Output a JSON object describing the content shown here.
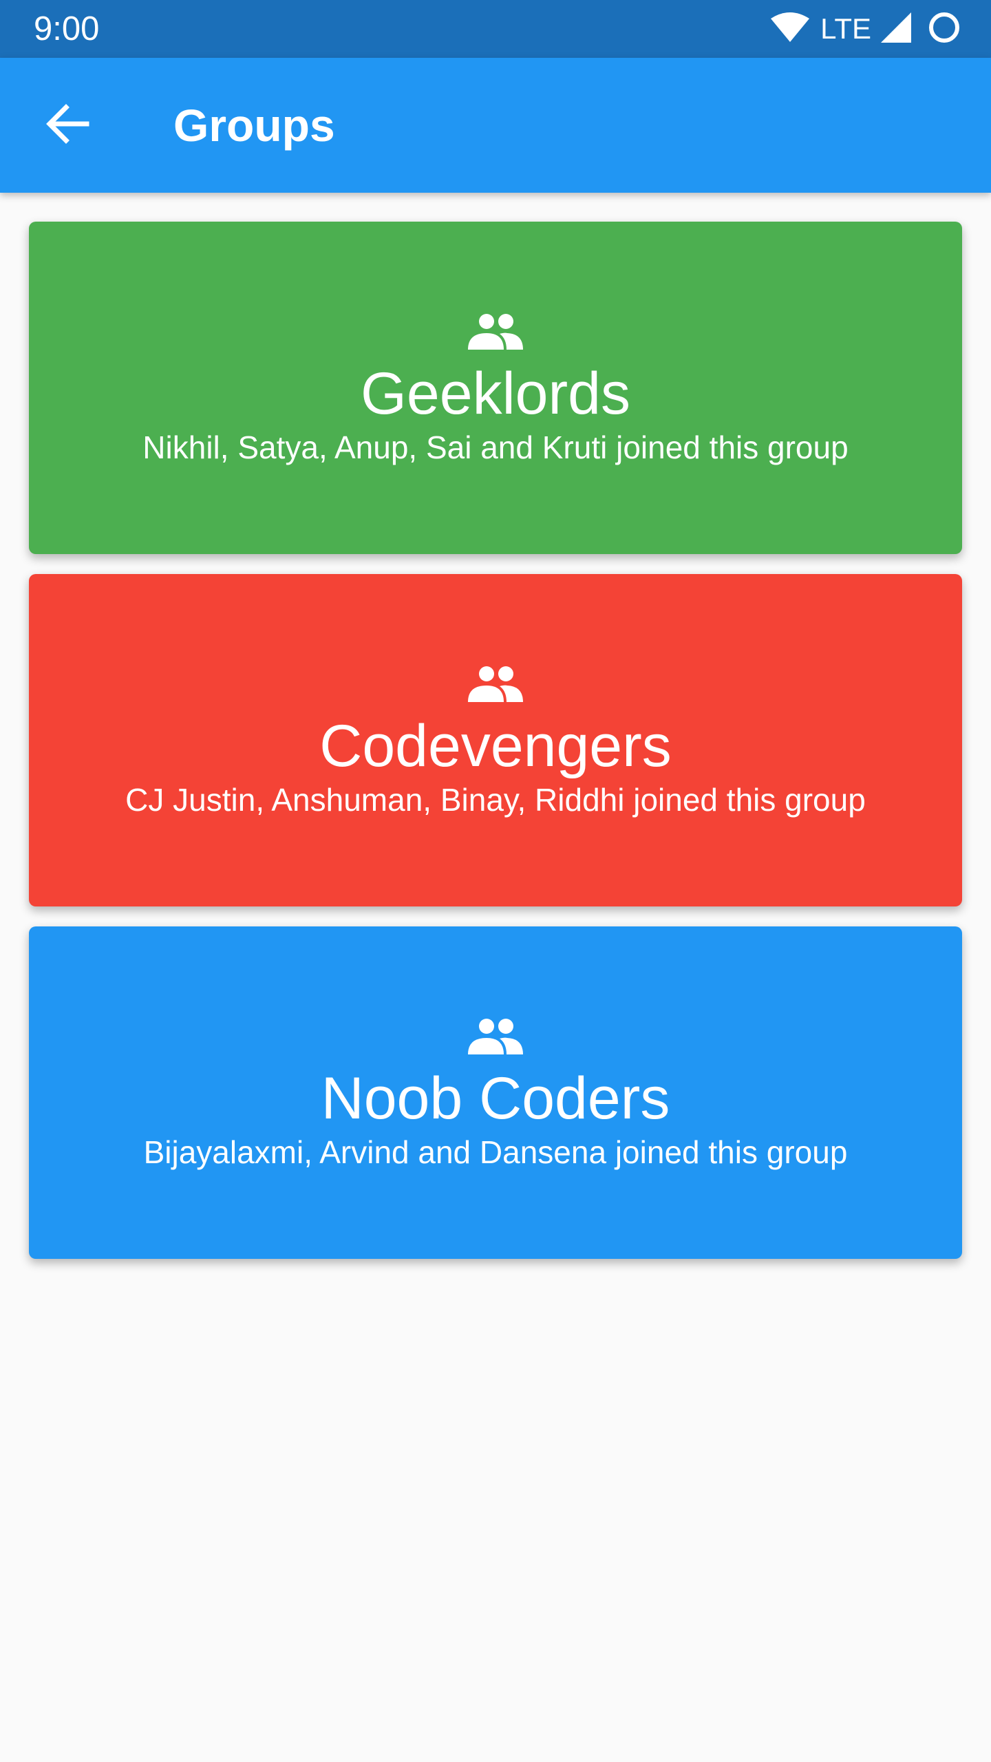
{
  "status_bar": {
    "time": "9:00",
    "network_label": "LTE",
    "icons": [
      "wifi-icon",
      "cell-signal-icon",
      "battery-circle-icon"
    ],
    "background": "#1b6fb9"
  },
  "app_bar": {
    "title": "Groups",
    "back_icon": "arrow-back-icon",
    "background": "#2196f3"
  },
  "groups": [
    {
      "name": "Geeklords",
      "members_text": "Nikhil, Satya, Anup, Sai and Kruti joined this group",
      "color": "#4caf50",
      "icon": "people-icon"
    },
    {
      "name": "Codevengers",
      "members_text": "CJ Justin, Anshuman, Binay, Riddhi joined this group",
      "color": "#f44336",
      "icon": "people-icon"
    },
    {
      "name": "Noob Coders",
      "members_text": "Bijayalaxmi, Arvind and Dansena joined this group",
      "color": "#2196f3",
      "icon": "people-icon"
    }
  ]
}
